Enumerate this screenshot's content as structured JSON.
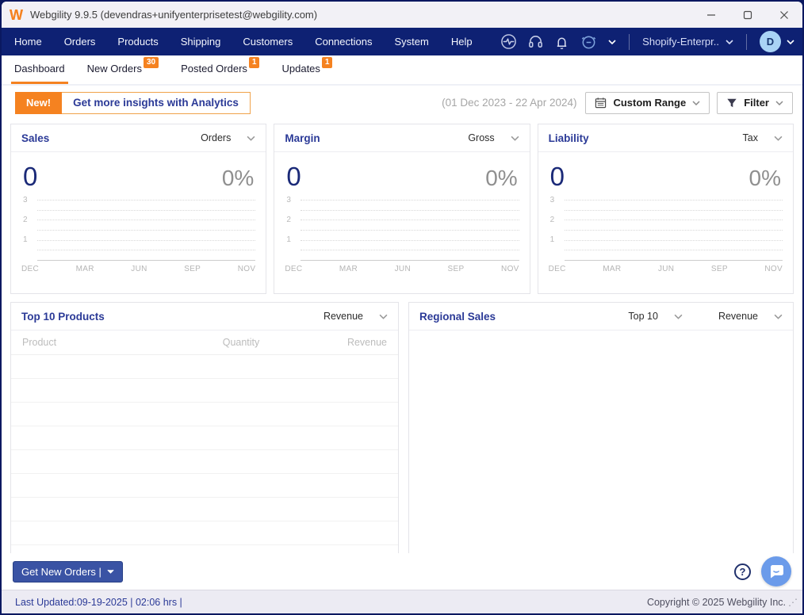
{
  "window": {
    "title": "Webgility 9.9.5 (devendras+unifyenterprisetest@webgility.com)",
    "logo_glyph": "W"
  },
  "menubar": {
    "items": [
      "Home",
      "Orders",
      "Products",
      "Shipping",
      "Customers",
      "Connections",
      "System",
      "Help"
    ],
    "store_selector": "Shopify-Enterpr..",
    "avatar_initial": "D"
  },
  "tabs": [
    {
      "label": "Dashboard",
      "badge": "",
      "active": true
    },
    {
      "label": "New Orders",
      "badge": "30",
      "active": false
    },
    {
      "label": "Posted Orders",
      "badge": "1",
      "active": false
    },
    {
      "label": "Updates",
      "badge": "1",
      "active": false
    }
  ],
  "toolbar": {
    "new_badge": "New!",
    "analytics_button": "Get more insights with Analytics",
    "date_range": "(01 Dec 2023 - 22 Apr 2024)",
    "custom_range_label": "Custom Range",
    "filter_label": "Filter"
  },
  "kpi_cards": [
    {
      "title": "Sales",
      "dropdown": "Orders",
      "value": "0",
      "percent": "0%"
    },
    {
      "title": "Margin",
      "dropdown": "Gross",
      "value": "0",
      "percent": "0%"
    },
    {
      "title": "Liability",
      "dropdown": "Tax",
      "value": "0",
      "percent": "0%"
    }
  ],
  "chart_axis": {
    "y_ticks": [
      "3",
      "2",
      "1"
    ],
    "x_ticks": [
      "DEC",
      "MAR",
      "JUN",
      "SEP",
      "NOV"
    ]
  },
  "chart_data": [
    {
      "type": "line",
      "title": "Sales (Orders)",
      "x": [
        "DEC",
        "MAR",
        "JUN",
        "SEP",
        "NOV"
      ],
      "y_ticks": [
        1,
        2,
        3
      ],
      "ylim": [
        0,
        3.5
      ],
      "series": [],
      "grid": "dotted horizontal",
      "note": "no data plotted"
    },
    {
      "type": "line",
      "title": "Margin (Gross)",
      "x": [
        "DEC",
        "MAR",
        "JUN",
        "SEP",
        "NOV"
      ],
      "y_ticks": [
        1,
        2,
        3
      ],
      "ylim": [
        0,
        3.5
      ],
      "series": [],
      "grid": "dotted horizontal",
      "note": "no data plotted"
    },
    {
      "type": "line",
      "title": "Liability (Tax)",
      "x": [
        "DEC",
        "MAR",
        "JUN",
        "SEP",
        "NOV"
      ],
      "y_ticks": [
        1,
        2,
        3
      ],
      "ylim": [
        0,
        3.5
      ],
      "series": [],
      "grid": "dotted horizontal",
      "note": "no data plotted"
    }
  ],
  "top_products": {
    "title": "Top 10 Products",
    "dropdown": "Revenue",
    "columns": {
      "product": "Product",
      "quantity": "Quantity",
      "revenue": "Revenue"
    },
    "rows": []
  },
  "regional_sales": {
    "title": "Regional Sales",
    "dropdown_top": "Top 10",
    "dropdown_metric": "Revenue"
  },
  "footer": {
    "get_new_orders": "Get New Orders |",
    "help_glyph": "?",
    "last_updated": "Last Updated:09-19-2025 | 02:06 hrs |",
    "copyright": "Copyright © 2025 Webgility Inc.",
    "grip_glyph": "⋰"
  },
  "colors": {
    "accent_orange": "#F58220",
    "menubar_navy": "#0E2173",
    "card_title_blue": "#2B3A97",
    "kpi_value_navy": "#1B2A78",
    "muted_gray": "#8F8F8F",
    "button_blue": "#3A53A4",
    "chat_blue": "#6B9BEA",
    "avatar_blue": "#A9D3F5",
    "statusbar_bg": "#ECEBF3"
  }
}
